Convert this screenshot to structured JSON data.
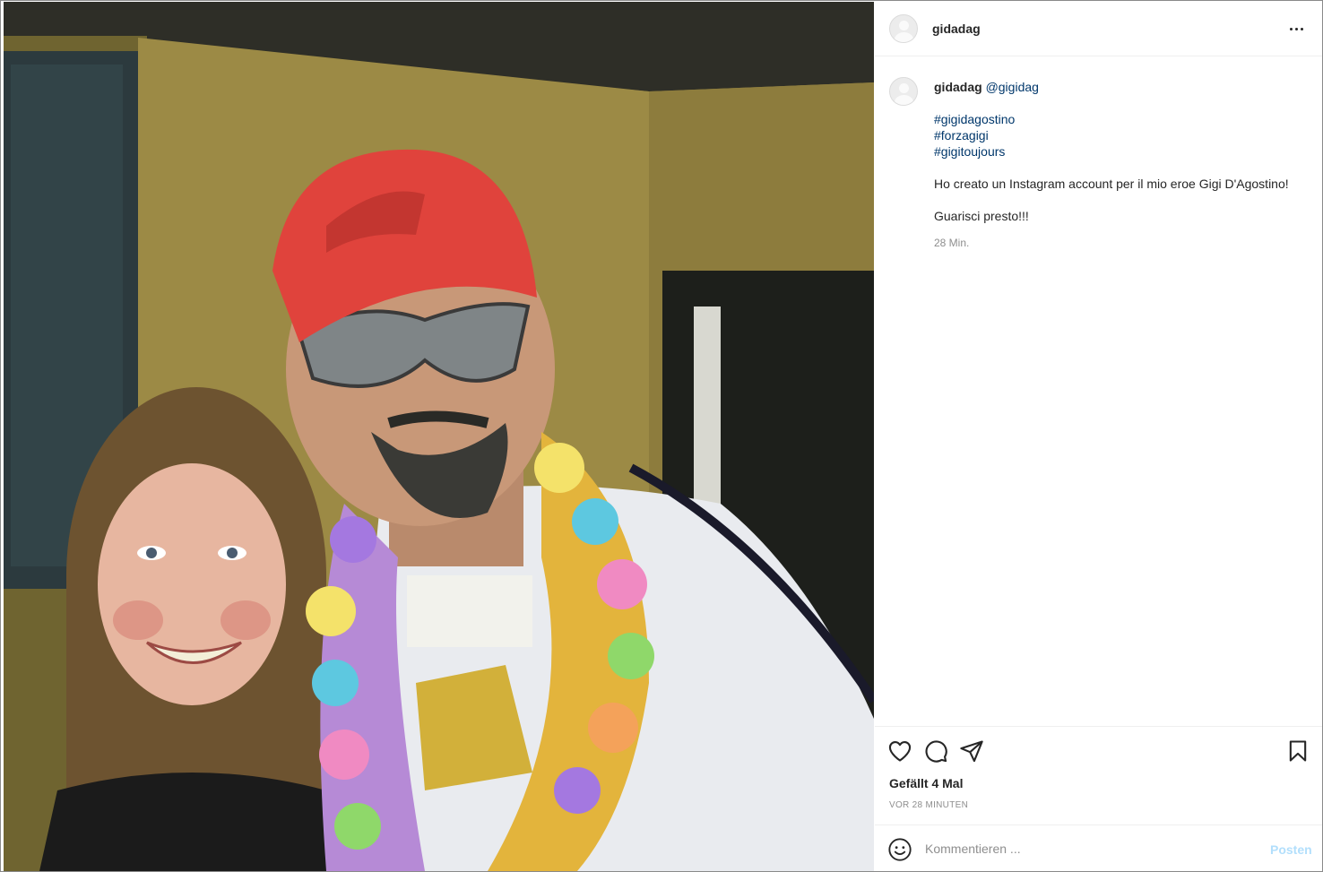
{
  "post": {
    "photo_alt": "Foto",
    "photo_icon": "photo"
  },
  "header": {
    "username": "gidadag",
    "avatar_icon": "avatar-icon",
    "more_icon": "more-options-icon"
  },
  "caption": {
    "username": "gidadag",
    "mention": "@gigidag",
    "hashtags": [
      "#gigidagostino",
      "#forzagigi",
      "#gigitoujours"
    ],
    "text": "Ho creato un Instagram account per il mio eroe Gigi D'Agostino!",
    "text2": "Guarisci presto!!!",
    "age": "28 Min."
  },
  "actions": {
    "icons": [
      "heart-icon",
      "comment-icon",
      "share-icon",
      "bookmark-icon"
    ],
    "likes": "Gefällt 4 Mal",
    "timestamp": "VOR 28 MINUTEN"
  },
  "comment": {
    "placeholder": "Kommentieren ...",
    "post_label": "Posten",
    "emoji_icon": "emoji-icon"
  },
  "colors": {
    "link": "#00376b",
    "text": "#262626",
    "muted": "#8e8e8e",
    "post_disabled": "#b2dffc"
  }
}
